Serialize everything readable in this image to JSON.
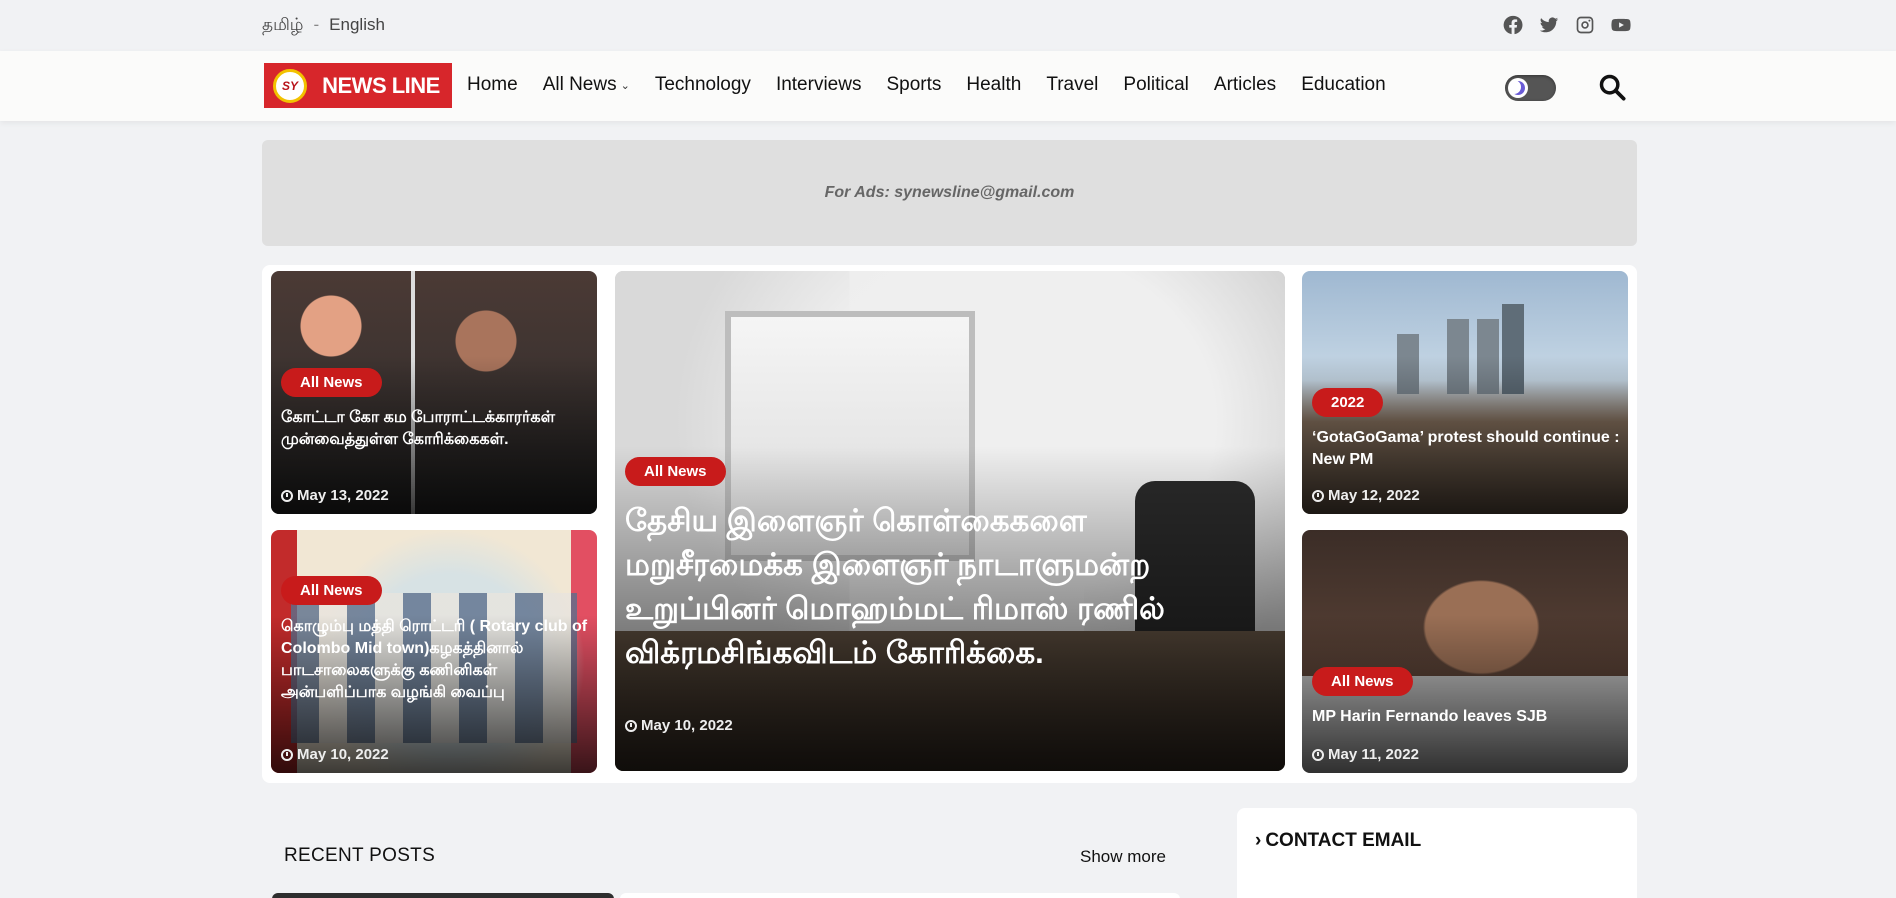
{
  "topbar": {
    "lang_tamil": "தமிழ்",
    "lang_sep": "-",
    "lang_english": "English",
    "socials": [
      "facebook-icon",
      "twitter-icon",
      "instagram-icon",
      "youtube-icon"
    ]
  },
  "nav": {
    "logo_mark": "SY",
    "logo_text": "NEWS LINE",
    "items": [
      "Home",
      "All News",
      "Technology",
      "Interviews",
      "Sports",
      "Health",
      "Travel",
      "Political",
      "Articles",
      "Education"
    ]
  },
  "ad": {
    "text": "For Ads: synewsline@gmail.com"
  },
  "featured": [
    {
      "badge": "All News",
      "title": "கோட்டா கோ கம போராட்டக்காரர்கள் முன்வைத்துள்ள கோரிக்கைகள்.",
      "date": "May 13, 2022"
    },
    {
      "badge": "All News",
      "title": "கொழும்பு மத்தி ரொட்டரி ( Rotary club of Colombo Mid town)கழகத்தினால் பாடசாலைகளுக்கு கணினிகள் அன்பளிப்பாக வழங்கி வைப்பு",
      "date": "May 10, 2022"
    },
    {
      "badge": "All News",
      "title": "தேசிய இளைஞர் கொள்கைகளை மறுசீரமைக்க இளைஞர் நாடாளுமன்ற உறுப்பினர் மொஹம்மட் ரிமாஸ் ரணில் விக்ரமசிங்கவிடம் கோரிக்கை.",
      "date": "May 10, 2022"
    },
    {
      "badge": "2022",
      "title": "‘GotaGoGama’ protest should continue : New PM",
      "date": "May 12, 2022"
    },
    {
      "badge": "All News",
      "title": "MP Harin Fernando leaves SJB",
      "date": "May 11, 2022"
    }
  ],
  "recent": {
    "title": "RECENT POSTS",
    "show_more": "Show more"
  },
  "contact": {
    "title": "CONTACT EMAIL"
  },
  "colors": {
    "accent": "#c81b1b",
    "logo_red": "#d7262b",
    "page_bg": "#f1f2f4"
  }
}
